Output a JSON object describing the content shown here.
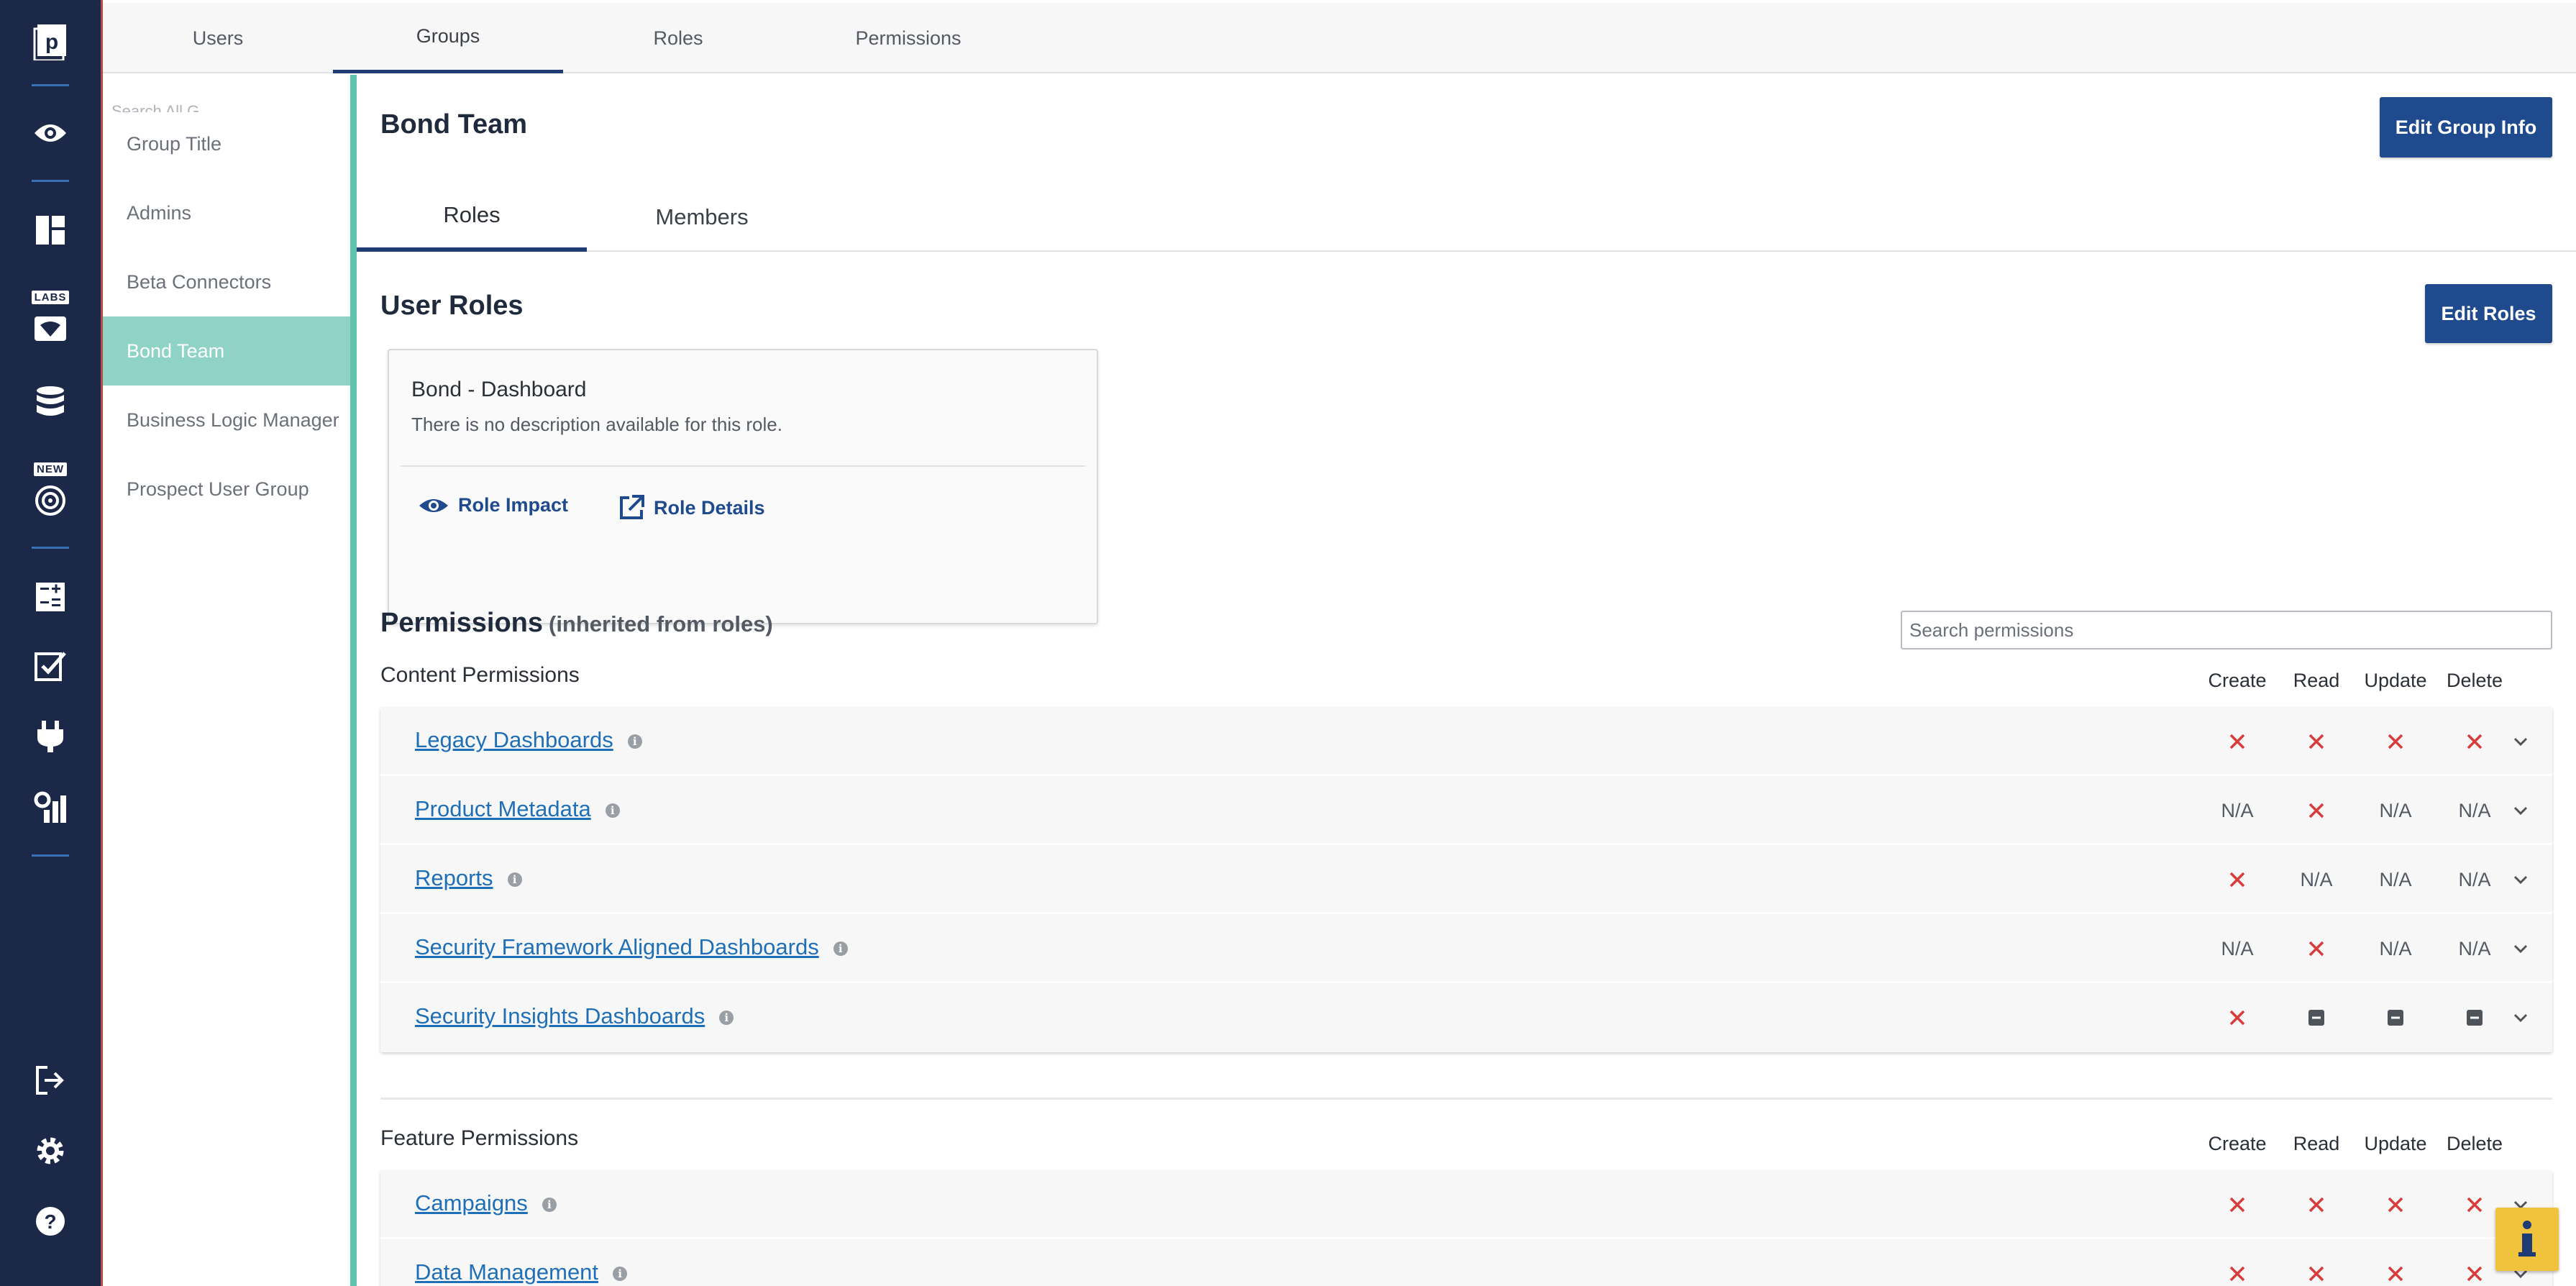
{
  "top_tabs": [
    {
      "label": "Users",
      "active": false
    },
    {
      "label": "Groups",
      "active": true
    },
    {
      "label": "Roles",
      "active": false
    },
    {
      "label": "Permissions",
      "active": false
    }
  ],
  "rail": {
    "logo_letter": "p",
    "labs_badge": "LABS",
    "new_badge": "NEW",
    "icons": [
      "logo-icon",
      "eye-icon",
      "dashboard-icon",
      "labs-icon",
      "database-icon",
      "target-icon",
      "calculator-icon",
      "checkbox-icon",
      "plug-icon",
      "report-settings-icon",
      "logout-icon",
      "gear-icon",
      "help-icon"
    ]
  },
  "groups": {
    "search_ghost": "Search All G...",
    "items": [
      {
        "label": "Group Title",
        "active": false
      },
      {
        "label": "Admins",
        "active": false
      },
      {
        "label": "Beta Connectors",
        "active": false
      },
      {
        "label": "Bond Team",
        "active": true
      },
      {
        "label": "Business Logic Manager",
        "active": false
      },
      {
        "label": "Prospect User Group",
        "active": false
      }
    ]
  },
  "group": {
    "title": "Bond Team",
    "edit_info_label": "Edit Group Info",
    "subtabs": [
      {
        "label": "Roles",
        "active": true
      },
      {
        "label": "Members",
        "active": false
      }
    ]
  },
  "user_roles": {
    "heading": "User Roles",
    "edit_label": "Edit Roles",
    "role": {
      "name": "Bond - Dashboard",
      "description": "There is no description available for this role.",
      "impact_label": "Role Impact",
      "details_label": "Role Details"
    }
  },
  "permissions": {
    "heading": "Permissions",
    "heading_suffix": "(inherited from roles)",
    "search_placeholder": "Search permissions",
    "columns": [
      "Create",
      "Read",
      "Update",
      "Delete"
    ],
    "content": {
      "label": "Content Permissions",
      "rows": [
        {
          "name": "Legacy Dashboards",
          "values": [
            "x",
            "x",
            "x",
            "x"
          ]
        },
        {
          "name": "Product Metadata",
          "values": [
            "N/A",
            "x",
            "N/A",
            "N/A"
          ]
        },
        {
          "name": "Reports",
          "values": [
            "x",
            "N/A",
            "N/A",
            "N/A"
          ]
        },
        {
          "name": "Security Framework Aligned Dashboards",
          "values": [
            "N/A",
            "x",
            "N/A",
            "N/A"
          ]
        },
        {
          "name": "Security Insights Dashboards",
          "values": [
            "x",
            "partial",
            "partial",
            "partial"
          ]
        }
      ]
    },
    "feature": {
      "label": "Feature Permissions",
      "rows": [
        {
          "name": "Campaigns",
          "values": [
            "x",
            "x",
            "x",
            "x"
          ]
        },
        {
          "name": "Data Management",
          "values": [
            "x",
            "x",
            "x",
            "x"
          ]
        }
      ]
    },
    "info_glyph": "i"
  },
  "help": {
    "glyph": "i"
  },
  "colors": {
    "rail": "#1c2847",
    "accent": "#5fc2ad",
    "active_group": "#8fd3c6",
    "button": "#1f4b8e",
    "link": "#1f6fb8",
    "deny": "#d93b3b"
  }
}
